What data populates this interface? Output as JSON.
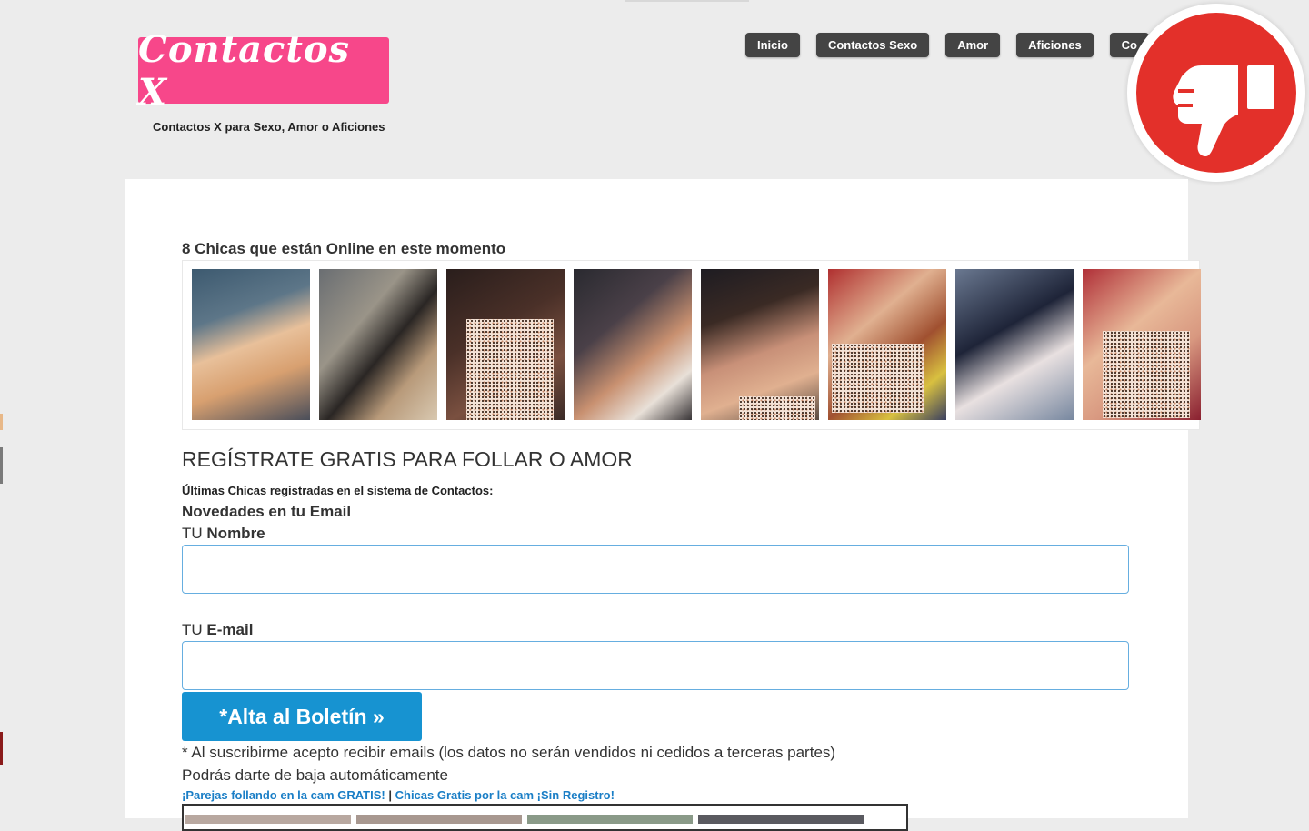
{
  "brand": {
    "logo_text": "Contactos X",
    "tagline": "Contactos X para Sexo, Amor o Aficiones",
    "logo_color": "#f7478a"
  },
  "nav": {
    "items": [
      "Inicio",
      "Contactos Sexo",
      "Amor",
      "Aficiones",
      "Co"
    ]
  },
  "badge": {
    "icon": "thumbs-down-icon",
    "color": "#e3302a"
  },
  "online": {
    "title": "8 Chicas que están Online en este momento",
    "photos": [
      {
        "bg": "linear-gradient(160deg,#3d5a70 0%,#5d7688 30%,#e8c09a 50%,#d8a070 70%,#4a4e5a 100%)",
        "censored": false
      },
      {
        "bg": "linear-gradient(130deg,#6a6e72 0%,#9a9488 35%,#2a2624 55%,#b89a7a 75%,#d8c8b0 100%)",
        "censored": false
      },
      {
        "bg": "linear-gradient(150deg,#2a1e1c 0%,#4a3028 40%,#7a5040 70%,#3a2a26 100%)",
        "censored": true
      },
      {
        "bg": "linear-gradient(140deg,#2a2a30 0%,#4a4048 35%,#c89070 60%,#e8e0d8 80%,#3a3638 100%)",
        "censored": false
      },
      {
        "bg": "linear-gradient(160deg,#1e1c22 0%,#3a2a24 30%,#c89078 55%,#e0b090 75%,#5a4a40 100%)",
        "censored": true
      },
      {
        "bg": "linear-gradient(140deg,#b03030 0%,#e0b090 35%,#a05030 60%,#d8c040 80%,#3a4060 100%)",
        "censored": true
      },
      {
        "bg": "linear-gradient(150deg,#6a7890 0%,#1e2438 40%,#e8e0e0 65%,#7888a0 100%)",
        "censored": false
      },
      {
        "bg": "linear-gradient(140deg,#b03038 0%,#e8b898 40%,#d89880 65%,#8a2030 100%)",
        "censored": true
      }
    ]
  },
  "registration": {
    "title": "REGÍSTRATE GRATIS PARA FOLLAR O AMOR",
    "latest_girls": "Últimas Chicas registradas en el sistema de Contactos:",
    "newsletter_heading": "Novedades en tu Email",
    "name_prefix": "TU",
    "name_label": "Nombre",
    "name_value": "",
    "email_prefix": "TU",
    "email_label": "E-mail",
    "email_value": "",
    "submit_label": "*Alta al Boletín »",
    "note": "* Al suscribirme acepto recibir emails (los datos no serán vendidos ni cedidos a terceras partes)",
    "unsubscribe": "Podrás darte de baja automáticamente"
  },
  "links": {
    "link1": "¡Parejas follando en la cam GRATIS!",
    "separator": "|",
    "link2": "Chicas Gratis por la cam ¡Sin Registro!"
  },
  "colors": {
    "accent_button": "#1793d1",
    "link": "#1a7ec6",
    "nav_bg": "#444444"
  }
}
